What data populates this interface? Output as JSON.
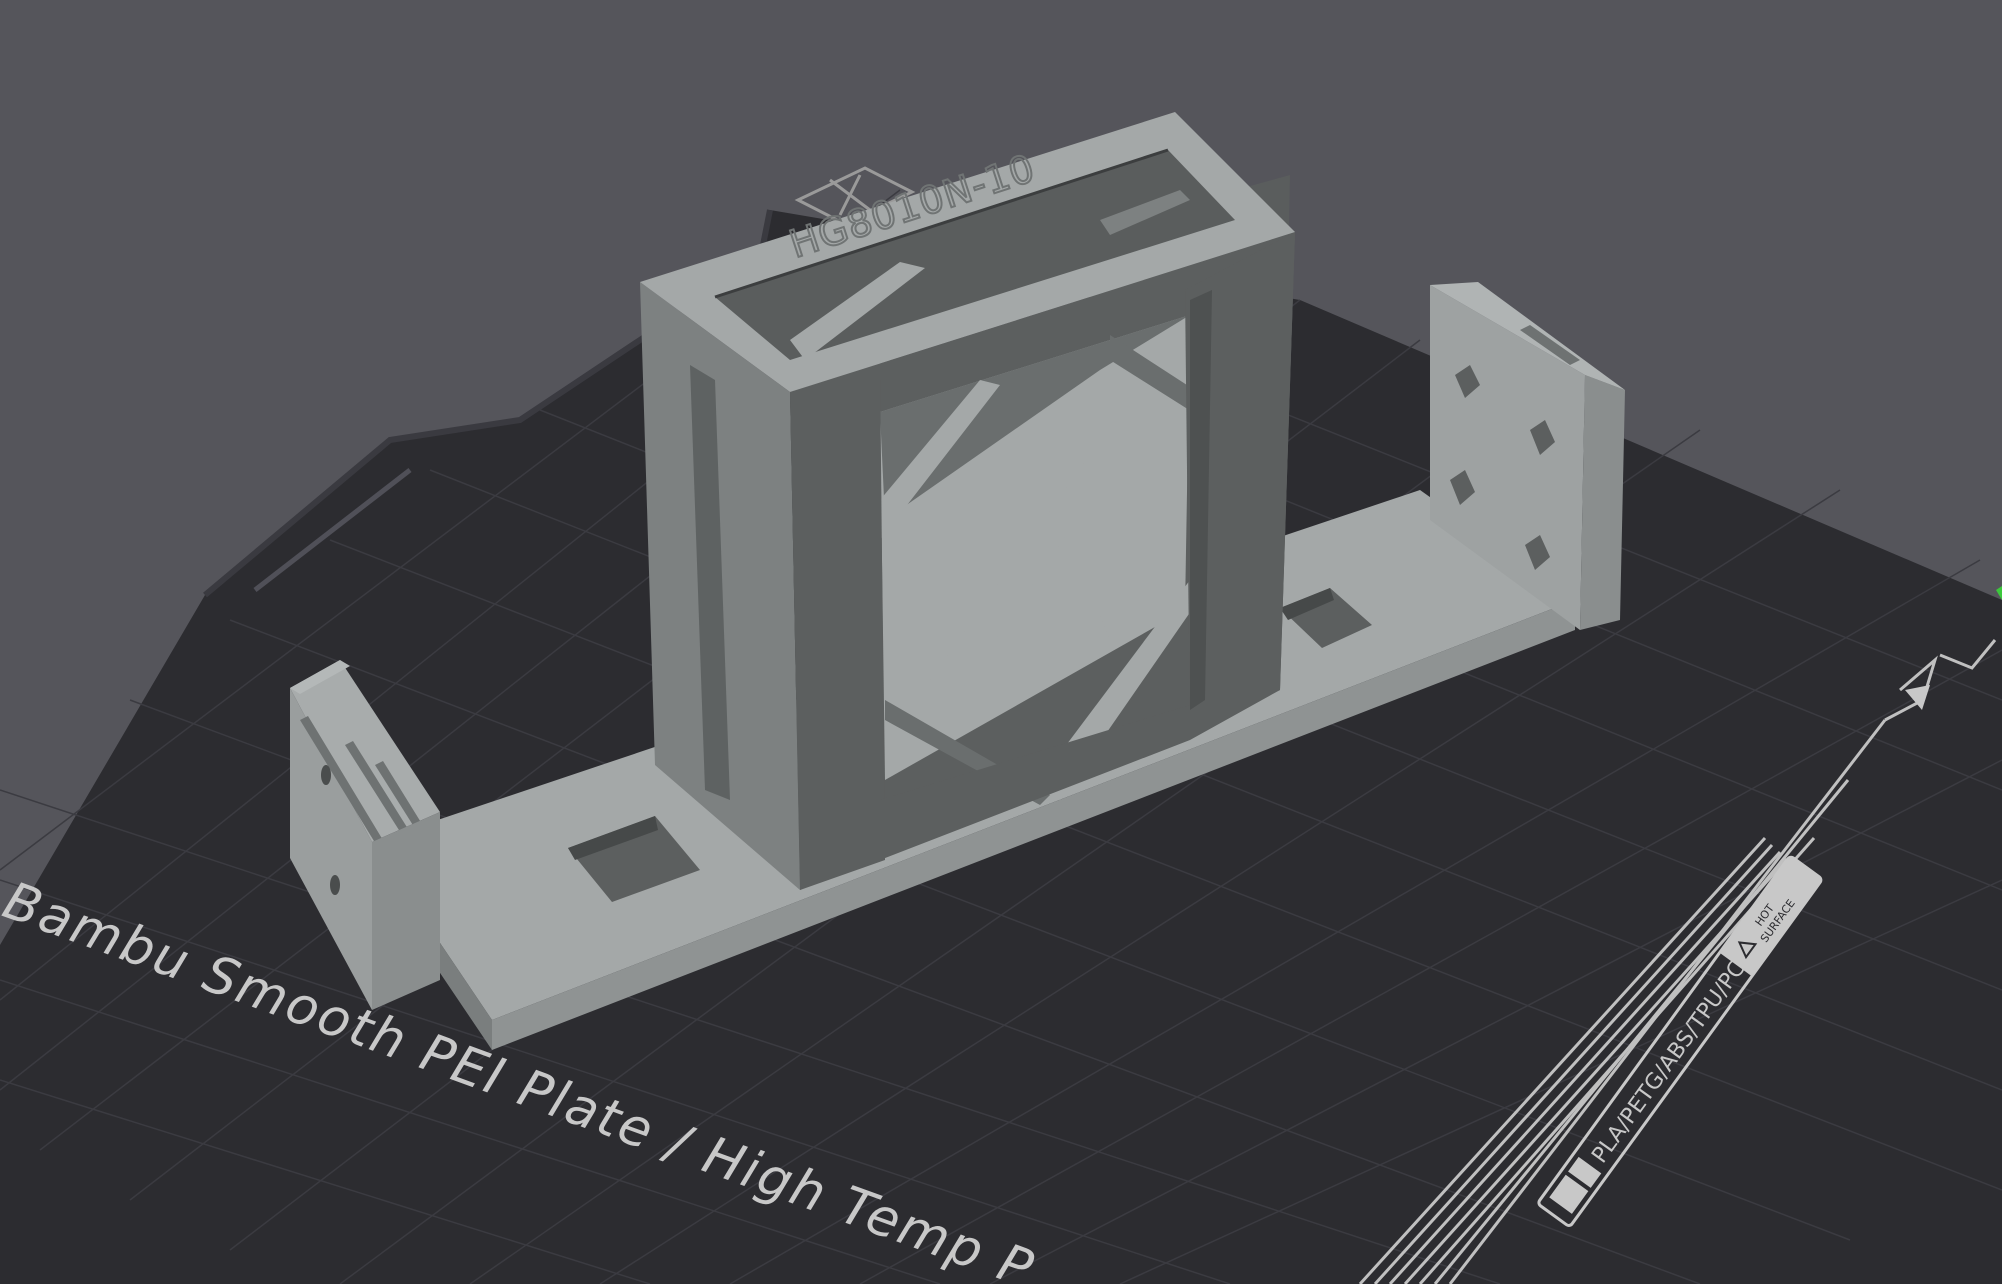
{
  "app": {
    "view": "3D prepare viewport"
  },
  "plate": {
    "name_text": "Bambu Smooth PEI Plate / High Temp P",
    "materials_text": "PLA/PETG/ABS/TPU/PC",
    "warning_line1": "HOT",
    "warning_line2": "SURFACE"
  },
  "model": {
    "embossed_label": "HG8010N-10"
  },
  "colors": {
    "background": "#55555b",
    "bed": "#2c2c30",
    "grid": "#3c3c42",
    "model_top": "#a4a8a8",
    "model_front": "#8f9393",
    "model_side": "#5c5f5f",
    "plate_print": "#c8c8c8",
    "axis_green": "#3cc83c"
  }
}
